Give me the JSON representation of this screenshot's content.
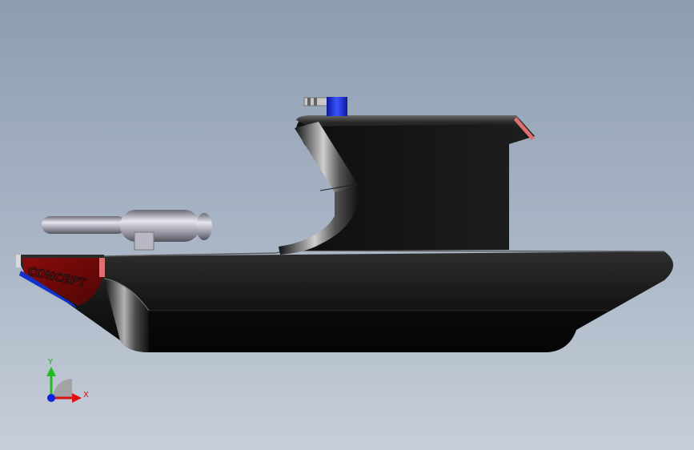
{
  "model": {
    "hull_decal_text": "CONCEPT"
  },
  "triad": {
    "y_label": "Y",
    "x_label": "X",
    "y_color": "#22bb22",
    "x_color": "#dd1111",
    "z_color": "#1122dd"
  },
  "colors": {
    "hull_body": "#1b1b1b",
    "bow_panel": "#7a0a0a",
    "stripe": "#1133cc",
    "knob": "#1a2fd8",
    "accent": "#e07070"
  }
}
